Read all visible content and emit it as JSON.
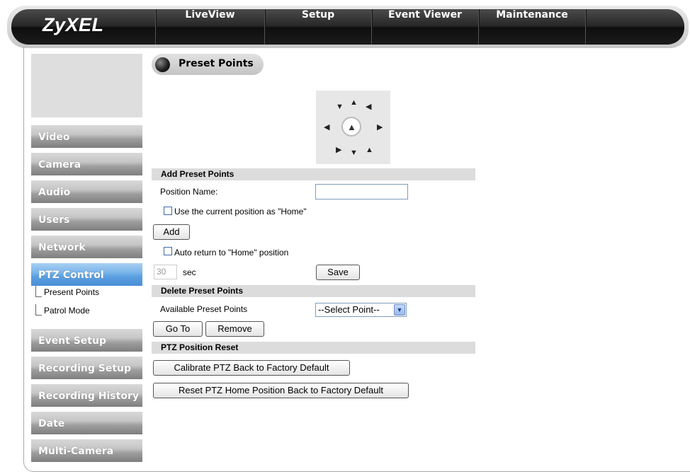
{
  "app": {
    "logo": "ZyXEL"
  },
  "nav": {
    "items": [
      {
        "label": "LiveView"
      },
      {
        "label": "Setup"
      },
      {
        "label": "Event Viewer"
      },
      {
        "label": "Maintenance"
      },
      {
        "label": ""
      }
    ]
  },
  "sidebar": {
    "items": [
      {
        "label": "Video"
      },
      {
        "label": "Camera"
      },
      {
        "label": "Audio"
      },
      {
        "label": "Users"
      },
      {
        "label": "Network"
      },
      {
        "label": "PTZ Control",
        "active": true
      },
      {
        "label": "Event Setup"
      },
      {
        "label": "Recording Setup"
      },
      {
        "label": "Recording History"
      },
      {
        "label": "Date"
      },
      {
        "label": "Multi-Camera"
      }
    ],
    "ptz_subitems": [
      {
        "label": "Present Points"
      },
      {
        "label": "Patrol Mode"
      }
    ]
  },
  "page": {
    "title": "Preset Points"
  },
  "ptz_pad": {
    "up_left": "▼",
    "up": "▲",
    "up_right": "◀",
    "left": "◀",
    "home": "▲",
    "right": "▶",
    "down_left": "▶",
    "down": "▼",
    "down_right": "▲"
  },
  "add_section": {
    "header": "Add Preset Points",
    "position_name_label": "Position Name:",
    "position_name_value": "",
    "home_checkbox_label": "Use the current position as \"Home\"",
    "add_button": "Add",
    "auto_return_label": "Auto return to \"Home\" position",
    "seconds_value": "30",
    "seconds_unit": "sec",
    "save_button": "Save"
  },
  "delete_section": {
    "header": "Delete Preset Points",
    "available_label": "Available Preset Points",
    "select_value": "--Select Point--",
    "goto_button": "Go To",
    "remove_button": "Remove"
  },
  "reset_section": {
    "header": "PTZ Position Reset",
    "calibrate_button": "Calibrate PTZ Back to Factory Default",
    "reset_home_button": "Reset PTZ Home Position Back to Factory Default"
  }
}
